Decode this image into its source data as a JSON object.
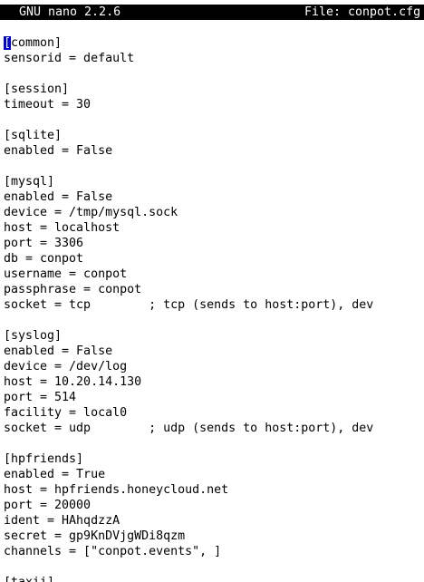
{
  "titlebar": {
    "app_name": "GNU nano 2.2.6",
    "file_label": "File: conpot.cfg"
  },
  "editor": {
    "cursor_char": "[",
    "first_line_rest": "common]",
    "lines": [
      "sensorid = default",
      "",
      "[session]",
      "timeout = 30",
      "",
      "[sqlite]",
      "enabled = False",
      "",
      "[mysql]",
      "enabled = False",
      "device = /tmp/mysql.sock",
      "host = localhost",
      "port = 3306",
      "db = conpot",
      "username = conpot",
      "passphrase = conpot",
      "socket = tcp        ; tcp (sends to host:port), dev",
      "",
      "[syslog]",
      "enabled = False",
      "device = /dev/log",
      "host = 10.20.14.130",
      "port = 514",
      "facility = local0",
      "socket = udp        ; udp (sends to host:port), dev",
      "",
      "[hpfriends]",
      "enabled = True",
      "host = hpfriends.honeycloud.net",
      "port = 20000",
      "ident = HAhqdzzA",
      "secret = gp9KnDVjgWDi8qzm",
      "channels = [\"conpot.events\", ]",
      ""
    ],
    "partial_last_line": "[taxii]"
  }
}
